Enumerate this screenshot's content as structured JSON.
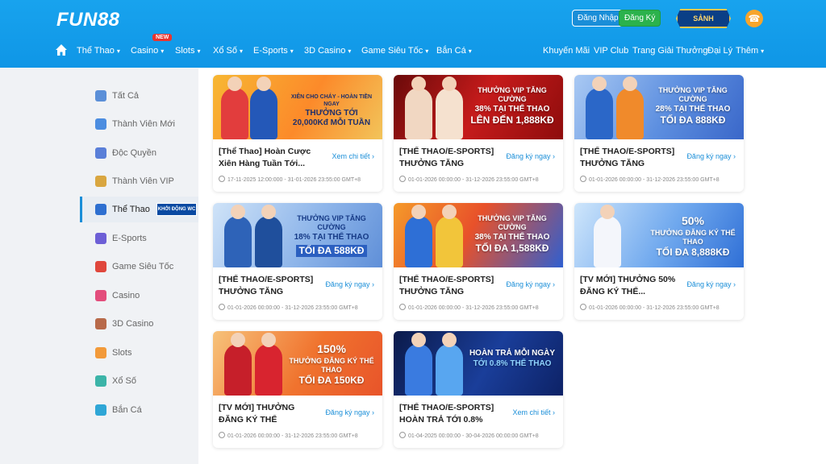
{
  "header": {
    "logo": "FUN88",
    "login_label": "Đăng Nhập",
    "register_label": "Đăng Ký",
    "hall_label": "SẢNH THƯỞNG",
    "new_badge": "NEW",
    "nav_left": [
      "Thể Thao",
      "Casino",
      "Slots",
      "Xổ Số",
      "E-Sports",
      "3D Casino",
      "Game Siêu Tốc",
      "Bắn Cá"
    ],
    "nav_right": [
      "Khuyến Mãi",
      "VIP Club",
      "Trang Giải Thưởng",
      "Đại Lý",
      "Thêm"
    ]
  },
  "sidebar": {
    "items": [
      "Tất Cả",
      "Thành Viên Mới",
      "Độc Quyền",
      "Thành Viên VIP",
      "Thể Thao",
      "E-Sports",
      "Game Siêu Tốc",
      "Casino",
      "3D Casino",
      "Slots",
      "Xổ Số",
      "Bắn Cá"
    ],
    "active_badge": "KHỞI ĐỘNG WC"
  },
  "cards": [
    {
      "title": "[Thể Thao] Hoàn Cược Xiên Hàng Tuần Tới...",
      "link": "Xem chi tiết",
      "date": "17-11-2025 12:00:000 - 31-01-2026 23:55:00 GMT+8",
      "banner": [
        "XIÊN CHO CHÁY - HOÀN TIỀN NGAY",
        "THƯỞNG TỚI",
        "20,000Kđ MỖI TUẦN"
      ]
    },
    {
      "title": "[THỂ THAO/E-SPORTS] THƯỞNG TĂNG CƯỜNG...",
      "link": "Đăng ký ngay",
      "date": "01-01-2026 00:00:00 - 31-12-2026 23:55:00 GMT+8",
      "banner": [
        "THƯỞNG VIP TĂNG CƯỜNG",
        "38% TẠI THỂ THAO",
        "LÊN ĐẾN 1,888KĐ"
      ]
    },
    {
      "title": "[THỂ THAO/E-SPORTS] THƯỞNG TĂNG CƯỜNG...",
      "link": "Đăng ký ngay",
      "date": "01-01-2026 00:00:00 - 31-12-2026 23:55:00 GMT+8",
      "banner": [
        "THƯỞNG VIP TĂNG CƯỜNG",
        "28% TẠI THỂ THAO",
        "TỐI ĐA 888KĐ"
      ]
    },
    {
      "title": "[THỂ THAO/E-SPORTS] THƯỞNG TĂNG CƯỜNG...",
      "link": "Đăng ký ngay",
      "date": "01-01-2026 00:00:00 - 31-12-2026 23:55:00 GMT+8",
      "banner": [
        "THƯỞNG VIP TĂNG CƯỜNG",
        "18% TẠI THỂ THAO",
        "TỐI ĐA 588KĐ"
      ]
    },
    {
      "title": "[THỂ THAO/E-SPORTS] THƯỞNG TĂNG CƯỜNG...",
      "link": "Đăng ký ngay",
      "date": "01-01-2026 00:00:00 - 31-12-2026 23:55:00 GMT+8",
      "banner": [
        "THƯỞNG VIP TĂNG CƯỜNG",
        "38% TẠI THỂ THAO",
        "TỐI ĐA 1,588KĐ"
      ]
    },
    {
      "title": "[TV MỚI] THƯỞNG 50% ĐĂNG KÝ THỂ...",
      "link": "Đăng ký ngay",
      "date": "01-01-2026 00:00:00 - 31-12-2026 23:55:00 GMT+8",
      "banner": [
        "50%",
        "THƯỞNG ĐĂNG KÝ THỂ THAO",
        "TỐI ĐA 8,888KĐ"
      ]
    },
    {
      "title": "[TV MỚI] THƯỞNG ĐĂNG KÝ THỂ THAO/ESPORTS",
      "link": "Đăng ký ngay",
      "date": "01-01-2026 00:00:00 - 31-12-2026 23:55:00 GMT+8",
      "banner": [
        "150%",
        "THƯỞNG ĐĂNG KÝ THỂ THAO",
        "TỐI ĐA 150KĐ"
      ]
    },
    {
      "title": "[THỂ THAO/E-SPORTS] HOÀN TRẢ TỚI 0.8%",
      "link": "Xem chi tiết",
      "date": "01-04-2025 00:00:00 - 30-04-2026 00:00:00 GMT+8",
      "banner": [
        "HOÀN TRẢ MỖI NGÀY",
        "TỚI 0.8% THỂ THAO",
        ""
      ]
    }
  ]
}
